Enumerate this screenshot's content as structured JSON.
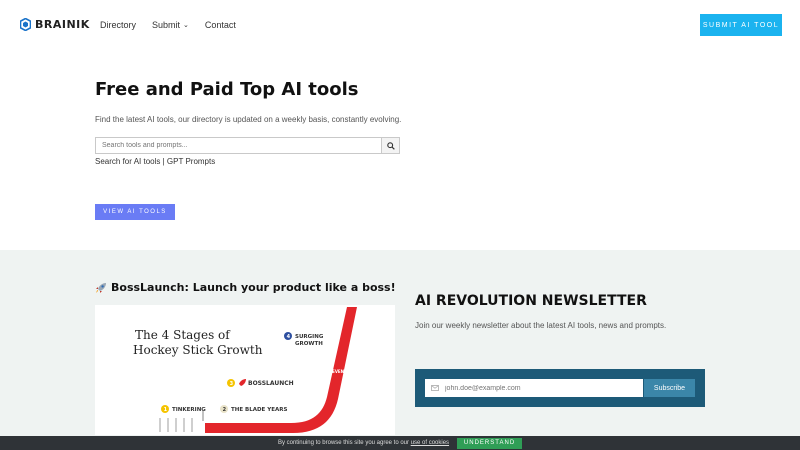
{
  "brand": {
    "name": "BRAINIK",
    "accent": "#1bb3ef"
  },
  "nav": {
    "items": [
      {
        "label": "Directory"
      },
      {
        "label": "Submit"
      },
      {
        "label": "Contact"
      }
    ],
    "cta_label": "SUBMIT AI TOOL"
  },
  "hero": {
    "title": "Free and Paid Top AI tools",
    "subtitle": "Find the latest AI tools, our directory is updated on a weekly basis, constantly evolving.",
    "search_placeholder": "Search tools and prompts...",
    "search_for": "Search for",
    "link_ai_tools": "AI tools",
    "separator": "|",
    "link_gpt_prompts": "GPT Prompts",
    "view_button": "VIEW AI TOOLS"
  },
  "bosslaunch": {
    "title": "BossLaunch: Launch your product like a boss!",
    "card": {
      "heading_line1": "The 4 Stages of",
      "heading_line2": "Hockey Stick Growth",
      "stage1_num": "1",
      "stage1": "TINKERING",
      "stage2_num": "2",
      "stage2": "THE BLADE YEARS",
      "stage3_num": "3",
      "stage3": "BOSSLAUNCH",
      "stage4_num": "4",
      "stage4_line1": "SURGING",
      "stage4_line2": "GROWTH",
      "stick_text": "REVENUE"
    }
  },
  "newsletter": {
    "title": "AI REVOLUTION NEWSLETTER",
    "subtitle": "Join our weekly newsletter about the latest AI tools, news and prompts.",
    "email_placeholder": "john.doe@example.com",
    "subscribe_label": "Subscribe"
  },
  "cookie": {
    "text": "By continuing to browse this site you agree to our",
    "link": "use of cookies",
    "button": "UNDERSTAND"
  }
}
